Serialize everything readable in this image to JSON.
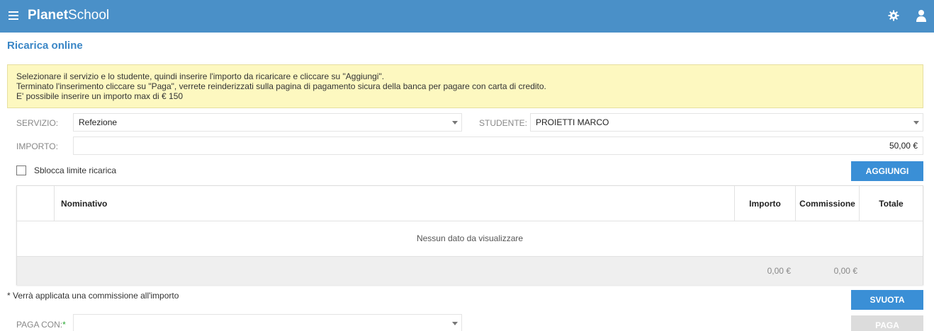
{
  "app": {
    "brand_bold": "Planet",
    "brand_light": "School"
  },
  "page": {
    "title": "Ricarica online"
  },
  "info": {
    "line1": "Selezionare il servizio e lo studente, quindi inserire l'importo da ricaricare e cliccare su \"Aggiungi\".",
    "line2": "Terminato l'inserimento cliccare su \"Paga\", verrete reinderizzati sulla pagina di pagamento sicura della banca per pagare con carta di credito.",
    "line3": "E' possibile inserire un importo max di € 150"
  },
  "form": {
    "servizio_label": "SERVIZIO:",
    "servizio_value": "Refezione",
    "studente_label": "STUDENTE:",
    "studente_value": "PROIETTI MARCO",
    "importo_label": "IMPORTO:",
    "importo_value": "50,00 €",
    "sblocca_label": "Sblocca limite ricarica",
    "sblocca_checked": false,
    "paga_con_label": "PAGA CON:",
    "paga_con_required": "*",
    "paga_con_value": ""
  },
  "buttons": {
    "aggiungi": "AGGIUNGI",
    "svuota": "SVUOTA",
    "paga": "PAGA"
  },
  "grid": {
    "columns": [
      "Nominativo",
      "Importo",
      "Commissione",
      "Totale"
    ],
    "empty_text": "Nessun dato da visualizzare",
    "footer": {
      "importo": "0,00 €",
      "commissione": "0,00 €"
    }
  },
  "note": "* Verrà applicata una commissione all'importo",
  "colors": {
    "topbar": "#4a90c8",
    "accent": "#3a8fd6",
    "info_bg": "#fdf8c0",
    "title": "#3a86c6",
    "required": "#2aa832"
  },
  "icons": {
    "menu": "hamburger-icon",
    "settings": "gear-icon",
    "account": "user-icon"
  }
}
